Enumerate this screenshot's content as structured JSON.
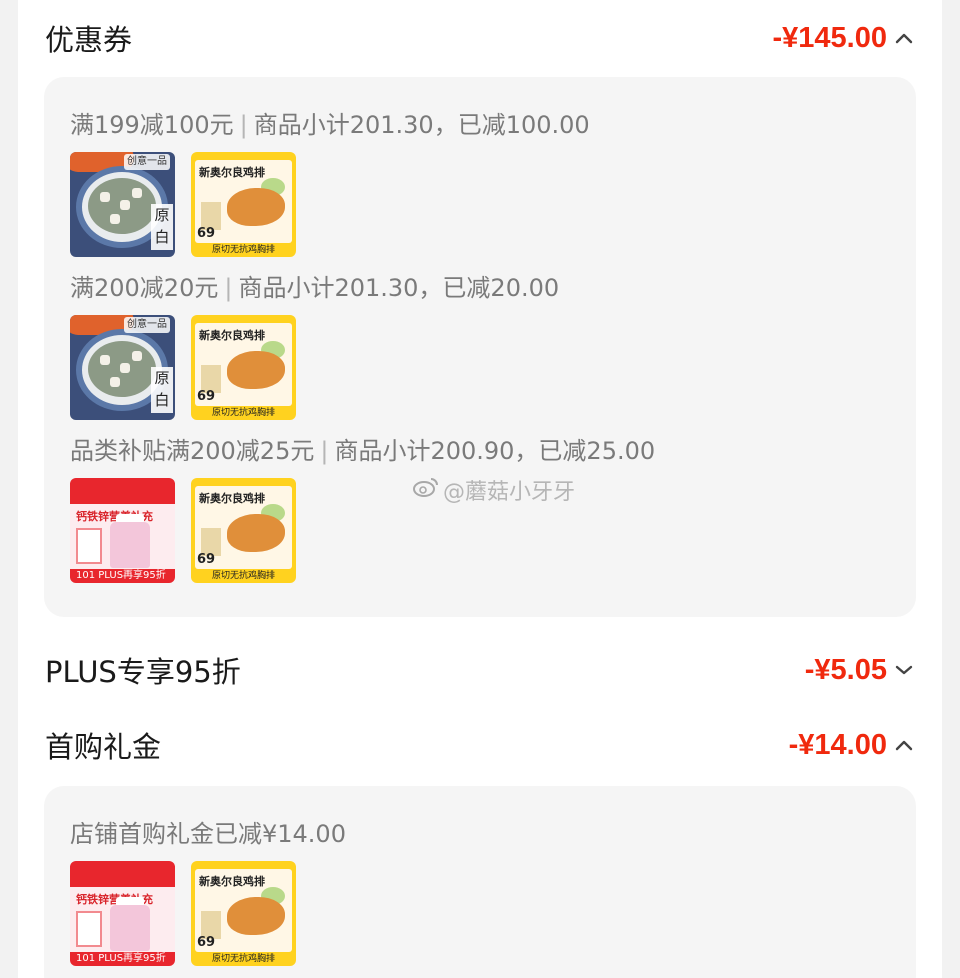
{
  "sections": {
    "coupon": {
      "title": "优惠券",
      "amount": "-¥145.00",
      "expanded": true
    },
    "plus": {
      "title": "PLUS专享95折",
      "amount": "-¥5.05",
      "expanded": false
    },
    "first_gift": {
      "title": "首购礼金",
      "amount": "-¥14.00",
      "expanded": true
    }
  },
  "coupon_rules": [
    {
      "label": "满199减100元",
      "detail": "商品小计201.30，已减100.00",
      "thumbs": [
        "food",
        "chicken"
      ]
    },
    {
      "label": "满200减20元",
      "detail": "商品小计201.30，已减20.00",
      "thumbs": [
        "food",
        "chicken"
      ]
    },
    {
      "label": "品类补贴满200减25元",
      "detail": "商品小计200.90，已减25.00",
      "thumbs": [
        "supplement",
        "chicken"
      ]
    }
  ],
  "first_gift_rule": {
    "label": "店铺首购礼金已减¥14.00",
    "thumbs": [
      "supplement",
      "chicken"
    ]
  },
  "thumb_text": {
    "food_tag": "创意一品",
    "food_side": "原白",
    "chicken_head": "新奥尔良鸡排",
    "chicken_price": "69",
    "chicken_foot": "原切无抗鸡胸排",
    "supp_text": "钙铁锌营养补充",
    "supp_bar": "101  PLUS再享95折"
  },
  "watermark": "@蘑菇小牙牙",
  "colors": {
    "accent": "#f0290e",
    "panel": "#f5f5f5",
    "muted": "#7a7a7a"
  },
  "icons": {
    "collapse": "chevron-up-icon",
    "expand": "chevron-down-icon"
  }
}
